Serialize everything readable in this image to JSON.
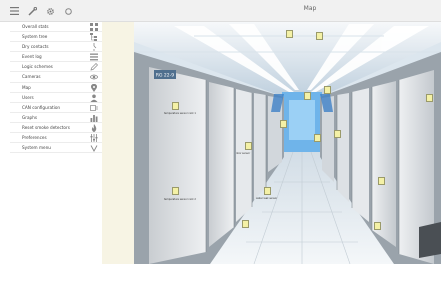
{
  "window": {
    "title": "Map"
  },
  "toolbar": {
    "icons": [
      "menu-icon",
      "tools-icon",
      "gear-icon",
      "circle-icon"
    ]
  },
  "sidebar": {
    "items": [
      {
        "label": "Overall stats",
        "icon": "grid-icon"
      },
      {
        "label": "System tree",
        "icon": "tree-icon"
      },
      {
        "label": "Dry contacts",
        "icon": "contact-icon"
      },
      {
        "label": "Event log",
        "icon": "list-icon"
      },
      {
        "label": "Logic schemes",
        "icon": "pencil-icon"
      },
      {
        "label": "Cameras",
        "icon": "eye-icon"
      },
      {
        "label": "Map",
        "icon": "map-pin-icon"
      },
      {
        "label": "Users",
        "icon": "user-icon"
      },
      {
        "label": "CAN configuration",
        "icon": "plug-icon"
      },
      {
        "label": "Graphs",
        "icon": "bar-chart-icon"
      },
      {
        "label": "Reset smoke detectors",
        "icon": "flame-icon"
      },
      {
        "label": "Preferences",
        "icon": "sliders-icon"
      },
      {
        "label": "System menu",
        "icon": "chevron-down-icon"
      }
    ]
  },
  "map": {
    "rack_sign": "RG 22-9",
    "markers": [
      {
        "label": "temperature sensor rack 1"
      },
      {
        "label": "temperature sensor rack 2"
      },
      {
        "label": "door sensor"
      },
      {
        "label": "water leak sensor"
      }
    ]
  },
  "colors": {
    "marker_fill": "#f4f1a6",
    "panel_bg": "#f7f4e4",
    "blue_light": "#5aa7e8"
  }
}
